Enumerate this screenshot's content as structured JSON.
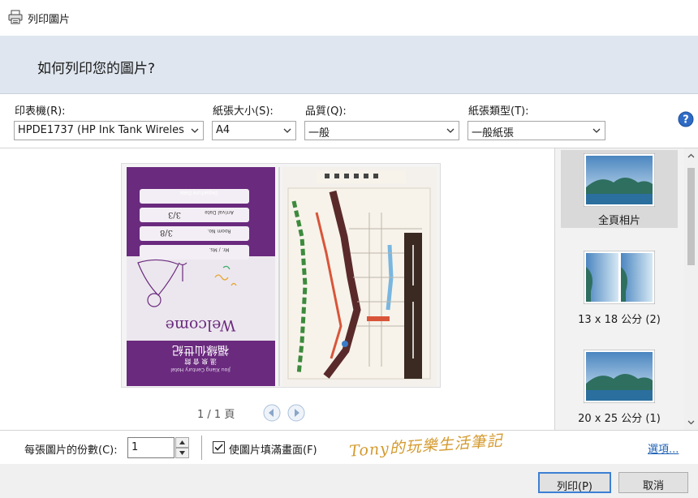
{
  "window": {
    "title": "列印圖片",
    "icon": "printer-icon"
  },
  "banner": {
    "heading": "如何列印您的圖片?"
  },
  "controls": {
    "printer": {
      "label": "印表機(R):",
      "value": "HPDE1737 (HP Ink Tank Wireles"
    },
    "paper_size": {
      "label": "紙張大小(S):",
      "value": "A4"
    },
    "quality": {
      "label": "品質(Q):",
      "value": "一般"
    },
    "paper_type": {
      "label": "紙張類型(T):",
      "value": "一般紙張"
    },
    "help_icon": "help-icon"
  },
  "preview": {
    "page_indicator": "1 / 1 頁",
    "card": {
      "welcome": "Welcome",
      "hotel_name_cn": "福緣仙世紀",
      "hotel_name_en": "Jiou Xiang Century Hotel",
      "tagline": "溫 泉 會 館",
      "departure_label": "Departure Date",
      "arrival_label": "Arrival Date",
      "room_label": "Room No.",
      "guest_label": "Mr. / Ms.",
      "room_value": "3/3",
      "arrival_value": "3/8"
    }
  },
  "layouts": [
    {
      "label": "全頁相片",
      "selected": true
    },
    {
      "label": "13 x 18 公分 (2)",
      "selected": false
    },
    {
      "label": "20 x 25 公分 (1)",
      "selected": false
    }
  ],
  "footer": {
    "copies_label": "每張圖片的份數(C):",
    "copies_value": "1",
    "fit_label": "使圖片填滿畫面(F)",
    "fit_checked": true,
    "watermark": "Tony的玩樂生活筆記",
    "options_link": "選項..."
  },
  "buttons": {
    "print": "列印(P)",
    "cancel": "取消"
  },
  "colors": {
    "banner": "#dfe6ef",
    "link": "#1a5fb4",
    "card_purple": "#6a2a7e",
    "watermark": "#d49a2e"
  }
}
